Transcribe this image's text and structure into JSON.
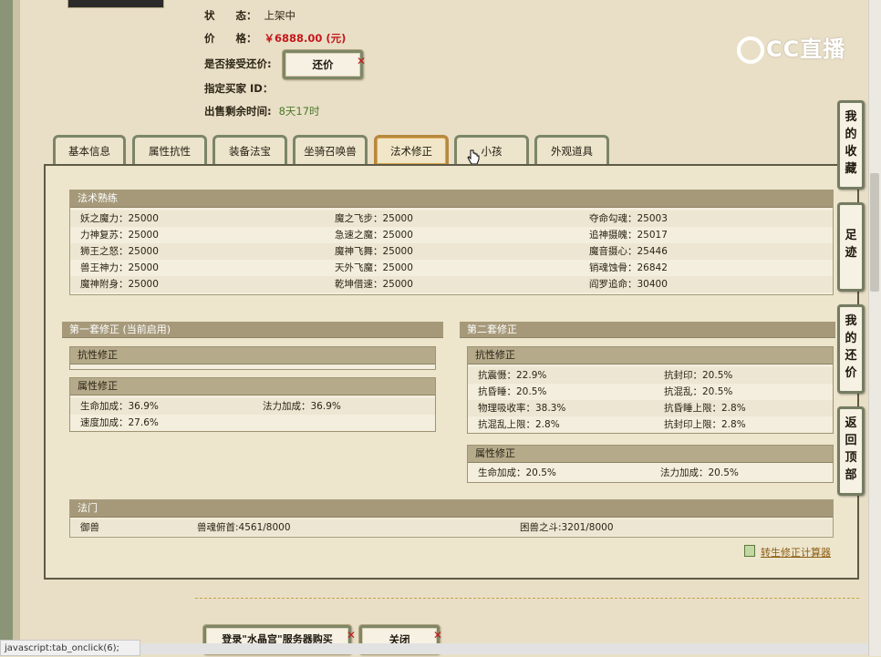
{
  "info": {
    "status_label": "状　　态：",
    "status_value": "上架中",
    "price_label": "价　　格：",
    "price_value": "￥6888.00 (元)",
    "counter_label": "是否接受还价:",
    "counter_button": "还价",
    "buyer_label": "指定买家 ID：",
    "buyer_value": "",
    "remain_label": "出售剩余时间:",
    "remain_value": "8天17时"
  },
  "logo_text": "CC直播",
  "tabs": [
    "基本信息",
    "属性抗性",
    "装备法宝",
    "坐骑召唤兽",
    "法术修正",
    "小孩",
    "外观道具"
  ],
  "active_tab": "法术修正",
  "skills": {
    "title": "法术熟练",
    "rows": [
      [
        "妖之魔力：25000",
        "魔之飞步：25000",
        "夺命勾魂：25003"
      ],
      [
        "力神复苏：25000",
        "急速之魔：25000",
        "追神摄魄：25017"
      ],
      [
        "狮王之怒：25000",
        "魔神飞舞：25000",
        "魔音摄心：25446"
      ],
      [
        "兽王神力：25000",
        "天外飞魔：25000",
        "销魂蚀骨：26842"
      ],
      [
        "魔神附身：25000",
        "乾坤借速：25000",
        "阎罗追命：30400"
      ]
    ]
  },
  "set1": {
    "title": "第一套修正 (当前启用)",
    "resist_title": "抗性修正",
    "attr_title": "属性修正",
    "attr_rows": [
      [
        "生命加成：36.9%",
        "法力加成：36.9%"
      ],
      [
        "速度加成：27.6%",
        ""
      ]
    ]
  },
  "set2": {
    "title": "第二套修正",
    "resist_title": "抗性修正",
    "resist_rows": [
      [
        "抗震慑：22.9%",
        "抗封印：20.5%"
      ],
      [
        "抗昏睡：20.5%",
        "抗混乱：20.5%"
      ],
      [
        "物理吸收率：38.3%",
        "抗昏睡上限：2.8%"
      ],
      [
        "抗混乱上限：2.8%",
        "抗封印上限：2.8%"
      ]
    ],
    "attr_title": "属性修正",
    "attr_rows": [
      [
        "生命加成：20.5%",
        "法力加成：20.5%"
      ]
    ]
  },
  "fashu": {
    "title": "法门",
    "cols": [
      "御兽",
      "兽魂俯首:4561/8000",
      "困兽之斗:3201/8000"
    ]
  },
  "calc_link": "转生修正计算器",
  "bottom_buttons": [
    "登录\"水晶宫\"服务器购买",
    "关闭"
  ],
  "side_buttons": [
    "我的收藏",
    "足迹",
    "我的还价",
    "返回顶部"
  ],
  "status_bar": "javascript:tab_onclick(6);",
  "colors": {
    "price": "#c4171c",
    "time": "#4b7a2c",
    "section_header": "#a6997a",
    "active_tab_border": "#b7883f"
  }
}
